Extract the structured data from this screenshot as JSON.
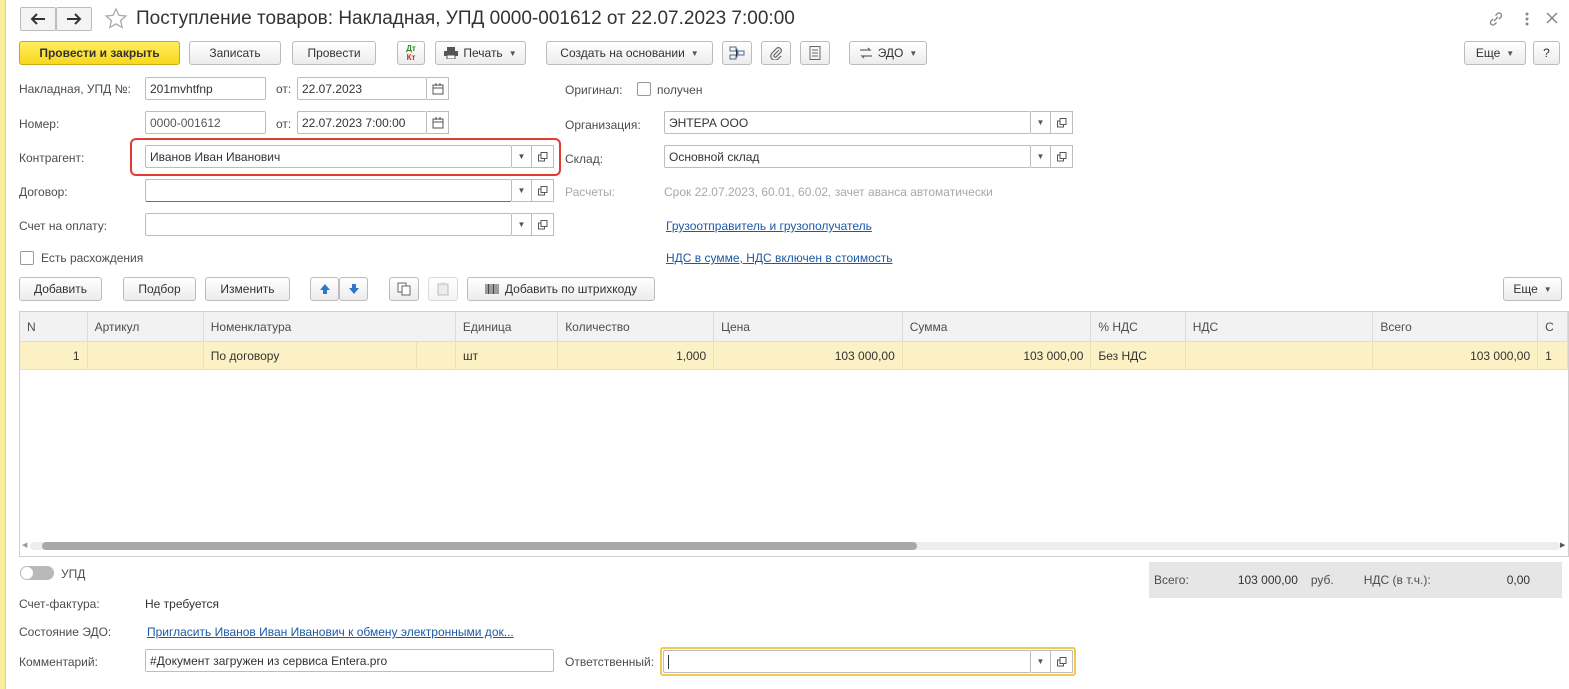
{
  "window": {
    "title": "Поступление товаров: Накладная, УПД 0000-001612 от 22.07.2023 7:00:00",
    "help_label": "?"
  },
  "toolbar": {
    "post_close": "Провести и закрыть",
    "save": "Записать",
    "post": "Провести",
    "dtkt_top": "Дт",
    "dtkt_bottom": "Кт",
    "print": "Печать",
    "create_based": "Создать на основании",
    "edo": "ЭДО",
    "more": "Еще"
  },
  "header": {
    "doc_label": "Накладная, УПД №:",
    "doc_number": "201mvhtfnp",
    "from_label": "от:",
    "doc_date": "22.07.2023",
    "number_label": "Номер:",
    "number_value": "0000-001612",
    "number_date": "22.07.2023  7:00:00",
    "counterparty_label": "Контрагент:",
    "counterparty_value": "Иванов Иван Иванович",
    "contract_label": "Договор:",
    "contract_value": "",
    "invoice_label": "Счет на оплату:",
    "invoice_value": "",
    "discrepancy_label": "Есть расхождения",
    "original_label": "Оригинал:",
    "original_received": "получен",
    "org_label": "Организация:",
    "org_value": "ЭНТЕРА ООО",
    "warehouse_label": "Склад:",
    "warehouse_value": "Основной склад",
    "settlements_label": "Расчеты:",
    "settlements_value": "Срок 22.07.2023, 60.01, 60.02, зачет аванса автоматически",
    "shipper_link": "Грузоотправитель и грузополучатель",
    "vat_link": "НДС в сумме, НДС включен в стоимость"
  },
  "table_toolbar": {
    "add": "Добавить",
    "select": "Подбор",
    "change": "Изменить",
    "barcode": "Добавить по штрихкоду",
    "more": "Еще"
  },
  "table": {
    "columns": [
      "N",
      "Артикул",
      "Номенклатура",
      "Единица",
      "Количество",
      "Цена",
      "Сумма",
      "% НДС",
      "НДС",
      "Всего",
      "С"
    ],
    "rows": [
      {
        "n": "1",
        "article": "",
        "item": "По договору",
        "unit": "шт",
        "qty": "1,000",
        "price": "103 000,00",
        "sum": "103 000,00",
        "vat_rate": "Без НДС",
        "vat": "",
        "total": "103 000,00",
        "extra": "1"
      }
    ]
  },
  "footer": {
    "upd_label": "УПД",
    "total_label": "Всего:",
    "total_value": "103 000,00",
    "currency": "руб.",
    "vat_label": "НДС (в т.ч.):",
    "vat_value": "0,00",
    "invoice_label": "Счет-фактура:",
    "invoice_value": "Не требуется",
    "edo_state_label": "Состояние ЭДО:",
    "edo_state_link": "Пригласить Иванов Иван Иванович к обмену электронными док...",
    "comment_label": "Комментарий:",
    "comment_value": "#Документ загружен из сервиса Entera.pro",
    "responsible_label": "Ответственный:",
    "responsible_value": ""
  }
}
